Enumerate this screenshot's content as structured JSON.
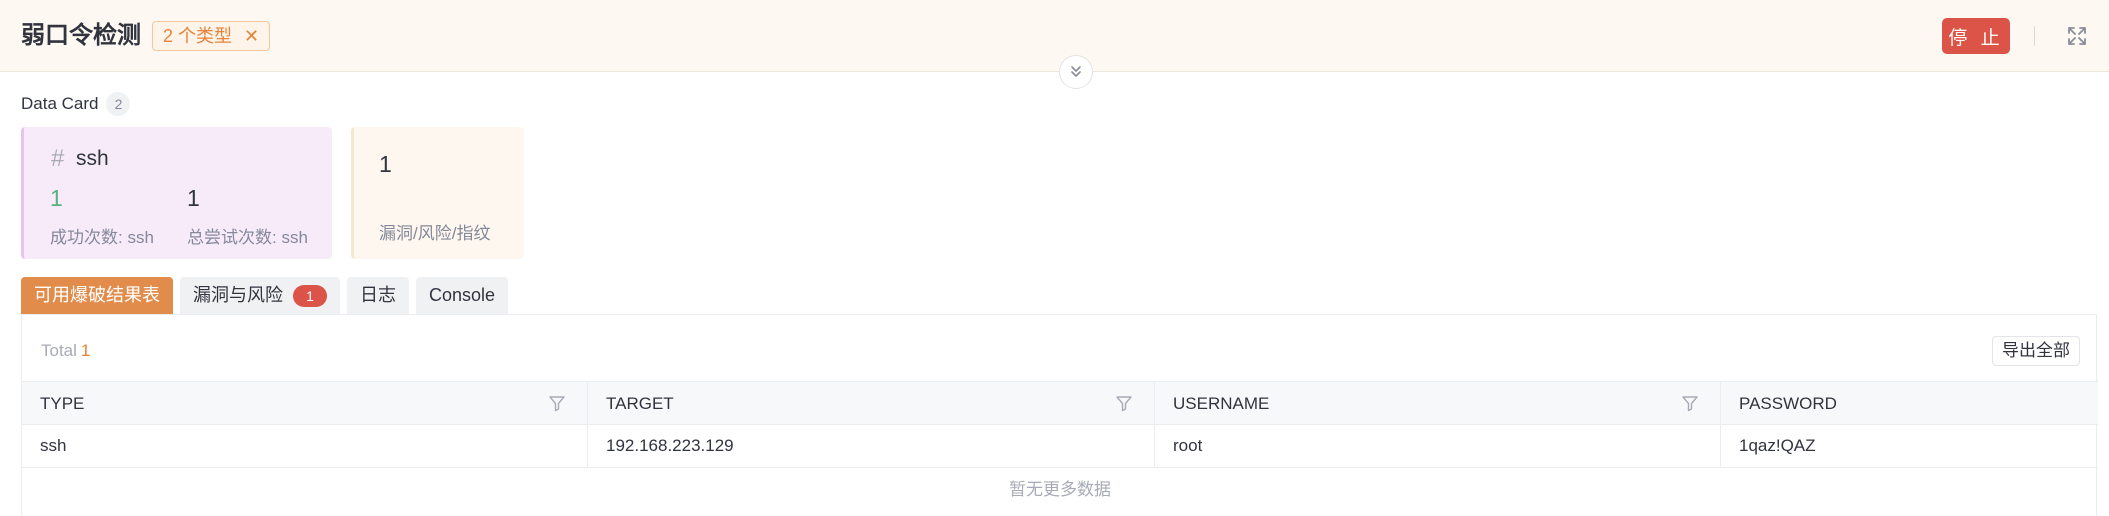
{
  "header": {
    "title": "弱口令检测",
    "type_tag": "2 个类型",
    "stop_label": "停 止"
  },
  "data_card": {
    "title": "Data Card",
    "count": "2",
    "cards": {
      "ssh": {
        "hash": "#",
        "name": "ssh",
        "success_value": "1",
        "success_label": "成功次数: ssh",
        "total_value": "1",
        "total_label": "总尝试次数: ssh"
      },
      "vuln": {
        "value": "1",
        "label": "漏洞/风险/指纹"
      }
    }
  },
  "tabs": [
    {
      "label": "可用爆破结果表"
    },
    {
      "label": "漏洞与风险",
      "badge": "1"
    },
    {
      "label": "日志"
    },
    {
      "label": "Console"
    }
  ],
  "table": {
    "total_label": "Total",
    "total_value": "1",
    "export_label": "导出全部",
    "columns": [
      "TYPE",
      "TARGET",
      "USERNAME",
      "PASSWORD"
    ],
    "rows": [
      [
        "ssh",
        "192.168.223.129",
        "root",
        "1qaz!QAZ"
      ]
    ],
    "empty_more": "暂无更多数据"
  },
  "colors": {
    "accent": "#e28c4c",
    "danger": "#dc5448",
    "success": "#56b27f",
    "tag_text": "#e6843a"
  },
  "icons": [
    "close-icon",
    "expand-icon",
    "double-chevron-down-icon",
    "filter-icon"
  ]
}
